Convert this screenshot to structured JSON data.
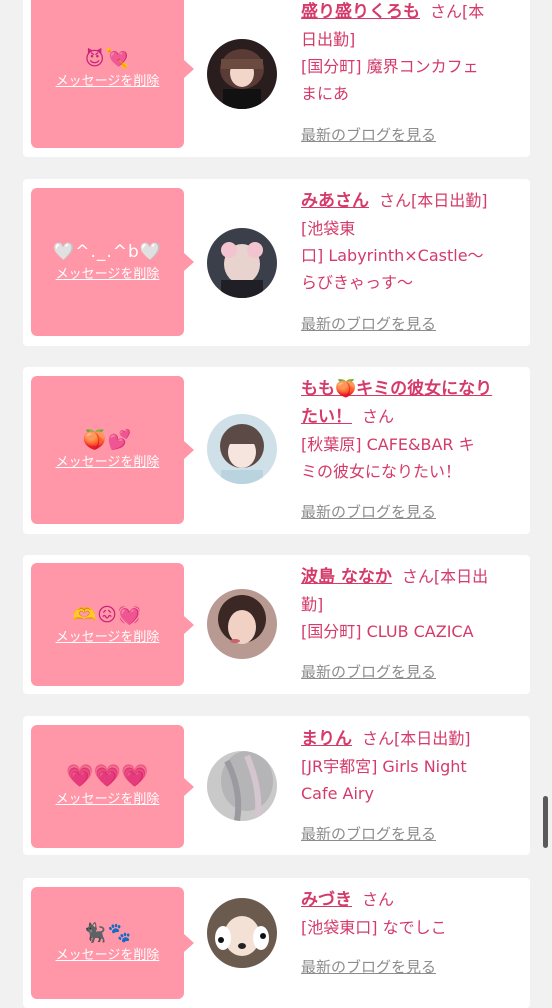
{
  "delete_label": "メッセージを削除",
  "blog_label": "最新のブログを見る",
  "colors": {
    "page_background": "#f2f1f1",
    "message_box": "#ff97a8",
    "name_text": "#d43a6a",
    "blog_link": "#8c8c8c"
  },
  "entries": [
    {
      "emoji": "😈💘",
      "name": "盛り盛りくろも",
      "line1_tail": "さん[本",
      "line2": "日出勤]",
      "line3": "[国分町] 魔界コンカフェ",
      "line4": "まにあ"
    },
    {
      "emoji": "🤍^._.^b🤍",
      "name": "みあさん",
      "line1_tail": "さん[本日出勤]",
      "line2": "[池袋東",
      "line3": "口] Labyrinth×Castle〜",
      "line4": "らびきゃっす〜"
    },
    {
      "emoji": "🍑💕",
      "name": "もも🍑キミの彼女になり",
      "line1_tail": "",
      "line2_name": "たい！",
      "line2_tail": "さん",
      "line3": "[秋葉原] CAFE&BAR キ",
      "line4": "ミの彼女になりたい！"
    },
    {
      "emoji": "🫶😖💓",
      "name": "波島 ななか",
      "line1_tail": "さん[本日出",
      "line2": "勤]",
      "line3": "[国分町] CLUB CAZICA"
    },
    {
      "emoji": "💗💗💗",
      "name": "まりん",
      "line1_tail": "さん[本日出勤]",
      "line2": "[JR宇都宮] Girls Night",
      "line3": "Cafe Airy"
    },
    {
      "emoji": "🐈‍⬛🐾",
      "name": "みづき",
      "line1_tail": "さん",
      "line2": "[池袋東口] なでしこ"
    }
  ]
}
